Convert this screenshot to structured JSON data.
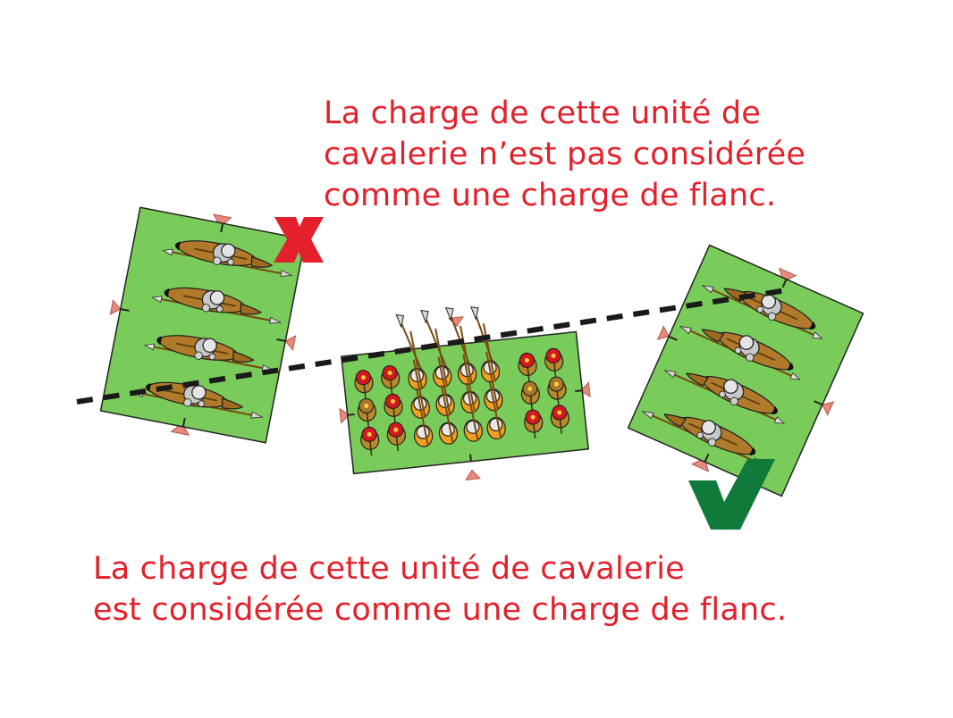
{
  "captions": {
    "top": [
      "La charge de cette unité de",
      "cavalerie n’est pas considérée",
      "comme une charge de flanc."
    ],
    "bottom": [
      "La charge de cette unité de cavalerie",
      "est considérée comme une charge de flanc."
    ]
  },
  "marks": {
    "cross_icon": "cross-icon",
    "check_icon": "check-icon"
  },
  "colors": {
    "text_red": "#e3202b",
    "cross_red": "#e3202b",
    "check_green": "#0f7a3a",
    "unit_base": "#7acc5a",
    "marker_pink": "#e8897c",
    "horse_brown": "#b07a2a",
    "shield_red": "#d8161e",
    "line_dark": "#1a1a1a"
  },
  "units": [
    {
      "id": "cavalry-left",
      "type": "cavalry",
      "result": "not-flank"
    },
    {
      "id": "infantry-center",
      "type": "pike-infantry",
      "result": "target"
    },
    {
      "id": "cavalry-right",
      "type": "cavalry",
      "result": "flank"
    }
  ]
}
